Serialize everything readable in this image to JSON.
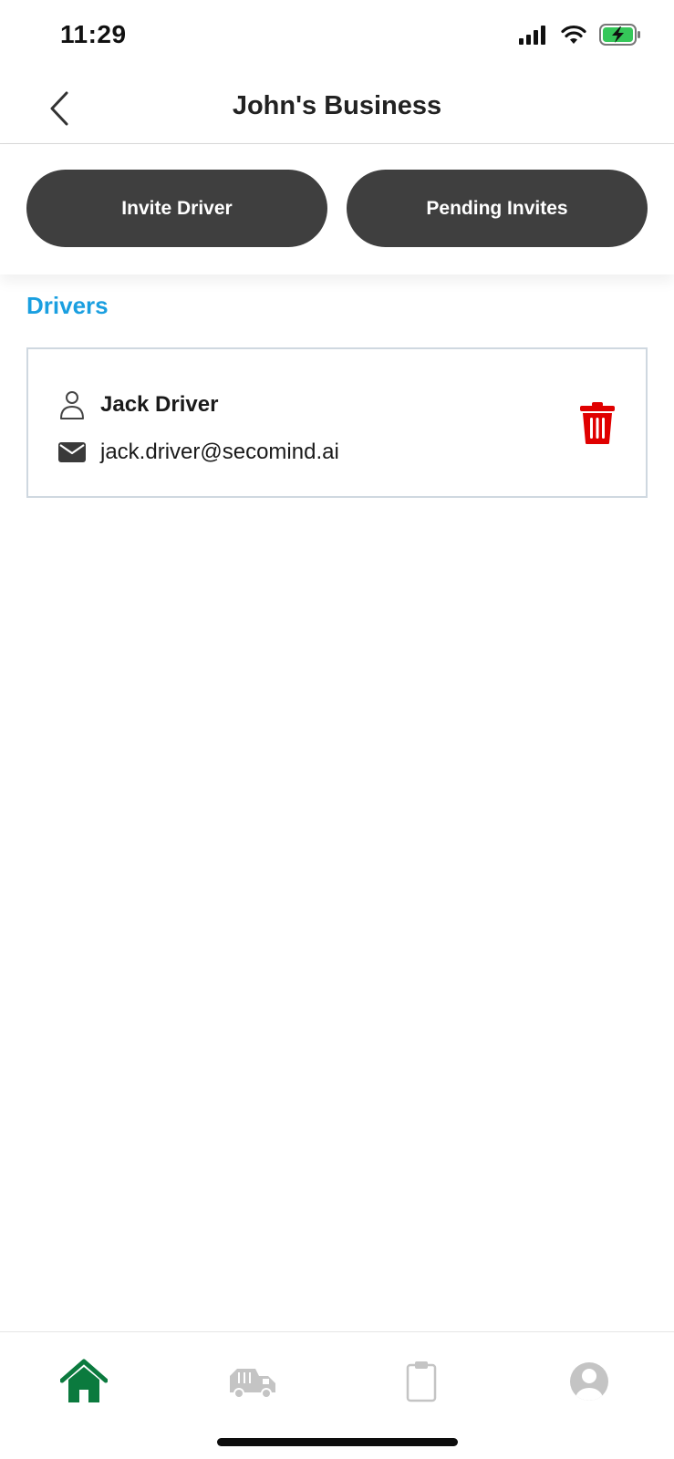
{
  "status_bar": {
    "time": "11:29",
    "icons": [
      "signal-icon",
      "wifi-icon",
      "battery-charging-icon"
    ]
  },
  "header": {
    "back_icon": "chevron-left-icon",
    "title": "John's Business"
  },
  "actions": {
    "invite_driver": "Invite Driver",
    "pending_invites": "Pending Invites"
  },
  "drivers_section": {
    "title": "Drivers",
    "drivers": [
      {
        "name": "Jack Driver",
        "email": "jack.driver@secomind.ai",
        "name_icon": "person-icon",
        "email_icon": "envelope-icon",
        "delete_icon": "trash-icon"
      }
    ]
  },
  "tab_bar": {
    "tabs": [
      {
        "icon": "home-icon",
        "active": true
      },
      {
        "icon": "truck-icon",
        "active": false
      },
      {
        "icon": "clipboard-icon",
        "active": false
      },
      {
        "icon": "profile-icon",
        "active": false
      }
    ]
  },
  "colors": {
    "accent": "#1a9fe0",
    "button_dark": "#3f3f3f",
    "delete_red": "#e00000",
    "tab_active": "#0b7a3e",
    "tab_inactive": "#c4c4c4",
    "battery_green": "#35c759"
  }
}
